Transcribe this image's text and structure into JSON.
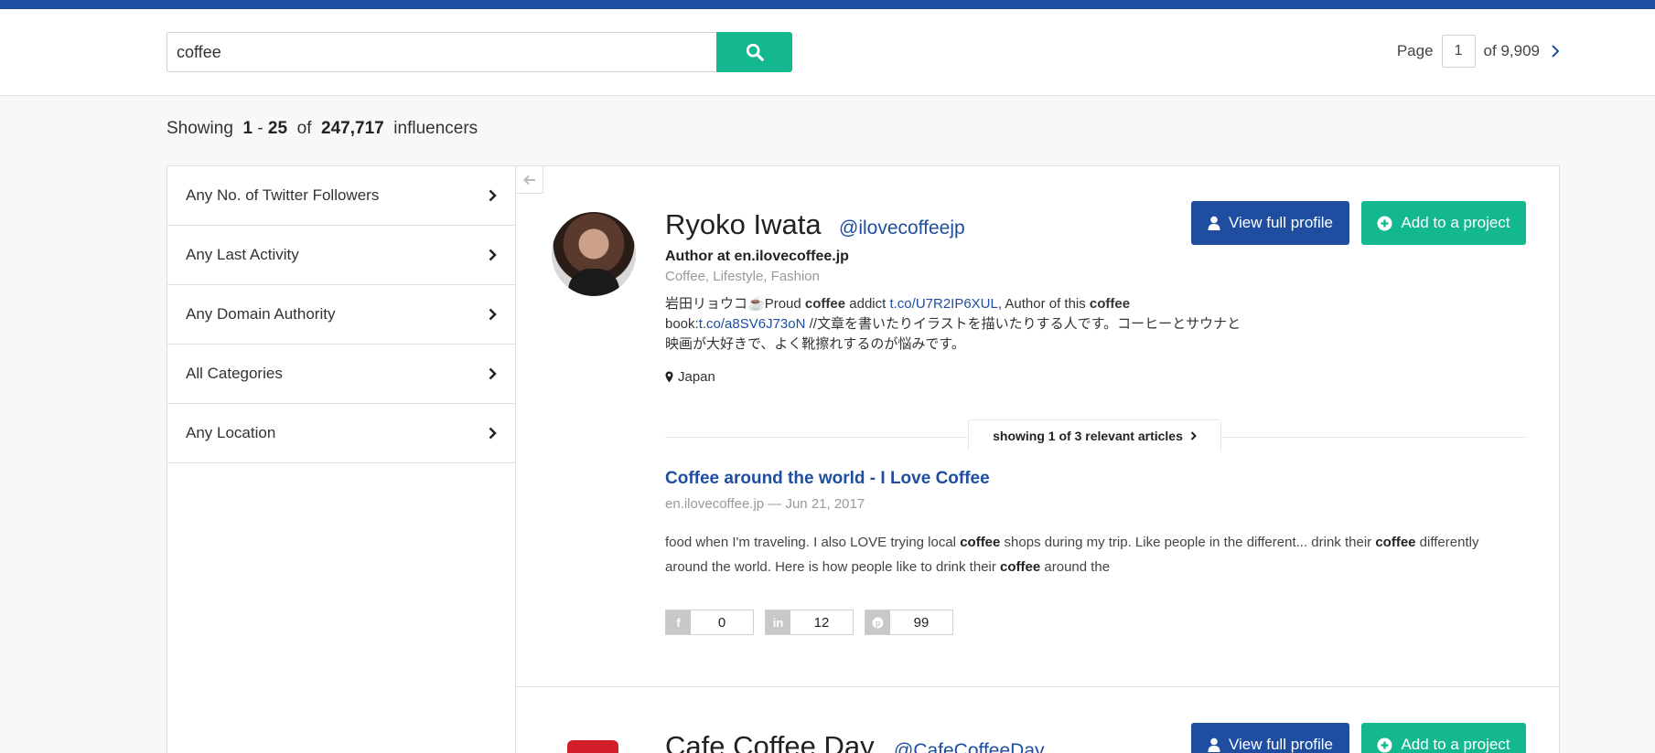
{
  "search": {
    "value": "coffee"
  },
  "pager": {
    "label": "Page",
    "current": "1",
    "of_label": "of 9,909"
  },
  "results": {
    "prefix": "Showing",
    "range_start": "1",
    "range_sep": "-",
    "range_end": "25",
    "of": "of",
    "total": "247,717",
    "suffix": "influencers"
  },
  "filters": [
    {
      "label": "Any No. of Twitter Followers"
    },
    {
      "label": "Any Last Activity"
    },
    {
      "label": "Any Domain Authority"
    },
    {
      "label": "All Categories"
    },
    {
      "label": "Any Location"
    }
  ],
  "influencers": [
    {
      "name": "Ryoko Iwata",
      "handle": "@ilovecoffeejp",
      "author": "Author at en.ilovecoffee.jp",
      "categories": "Coffee, Lifestyle, Fashion",
      "bio": {
        "p1": "岩田リョウコ",
        "p2": "Proud ",
        "k1": "coffee",
        "p3": " addict ",
        "link1": "t.co/U7R2IP6XUL",
        "p4": ", Author of this ",
        "k2": "coffee",
        "p5": " book:",
        "link2": "t.co/a8SV6J73oN",
        "p6": " //文章を書いたりイラストを描いたりする人です。コーヒーとサウナと映画が大好きで、よく靴擦れするのが悩みです。"
      },
      "location": "Japan",
      "view_label": "View full profile",
      "add_label": "Add to a project",
      "articles_label": "showing 1 of 3 relevant articles",
      "article": {
        "title": "Coffee around the world - I Love Coffee",
        "meta": "en.ilovecoffee.jp — Jun 21, 2017",
        "s1": "food when I'm traveling. I also LOVE trying local ",
        "k1": "coffee",
        "s2": " shops during my trip. Like people in the different... drink their ",
        "k2": "coffee",
        "s3": " differently around the world. Here is how people like to drink their ",
        "k3": "coffee",
        "s4": " around the"
      },
      "shares": {
        "facebook": "0",
        "linkedin": "12",
        "pinterest": "99"
      }
    },
    {
      "name": "Cafe Coffee Day",
      "handle": "@CafeCoffeeDay",
      "view_label": "View full profile",
      "add_label": "Add to a project"
    }
  ]
}
